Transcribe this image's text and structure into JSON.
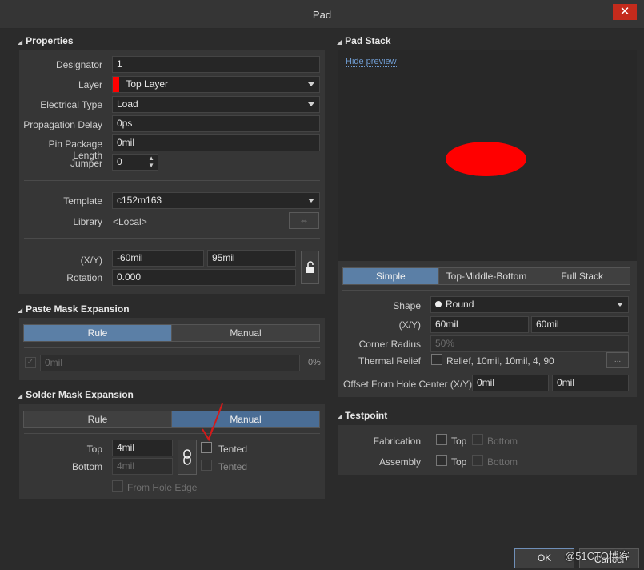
{
  "window": {
    "title": "Pad",
    "close_glyph": "✕"
  },
  "properties": {
    "heading": "Properties",
    "designator_label": "Designator",
    "designator_value": "1",
    "layer_label": "Layer",
    "layer_value": "Top Layer",
    "layer_color": "#ff0000",
    "electrical_type_label": "Electrical Type",
    "electrical_type_value": "Load",
    "propagation_delay_label": "Propagation Delay",
    "propagation_delay_value": "0ps",
    "pin_package_length_label": "Pin Package Length",
    "pin_package_length_value": "0mil",
    "jumper_label": "Jumper",
    "jumper_value": "0",
    "template_label": "Template",
    "template_value": "c152m163",
    "library_label": "Library",
    "library_value": "<Local>",
    "xy_label": "(X/Y)",
    "x_value": "-60mil",
    "y_value": "95mil",
    "rotation_label": "Rotation",
    "rotation_value": "0.000"
  },
  "paste_mask": {
    "heading": "Paste Mask Expansion",
    "tabs": [
      "Rule",
      "Manual"
    ],
    "value": "0mil",
    "percent": "0%"
  },
  "solder_mask": {
    "heading": "Solder Mask Expansion",
    "tabs": [
      "Rule",
      "Manual"
    ],
    "top_label": "Top",
    "top_value": "4mil",
    "bottom_label": "Bottom",
    "bottom_value": "4mil",
    "tented_label": "Tented",
    "tented_bottom_label": "Tented",
    "from_hole_edge_label": "From Hole Edge"
  },
  "pad_stack": {
    "heading": "Pad Stack",
    "hide_preview": "Hide preview",
    "pad_color": "#ff0000",
    "tabs": [
      "Simple",
      "Top-Middle-Bottom",
      "Full Stack"
    ],
    "shape_label": "Shape",
    "shape_value": "Round",
    "xy_label": "(X/Y)",
    "x_value": "60mil",
    "y_value": "60mil",
    "corner_radius_label": "Corner Radius",
    "corner_radius_value": "50%",
    "thermal_relief_label": "Thermal Relief",
    "thermal_relief_value": "Relief, 10mil, 10mil, 4, 90",
    "thermal_btn": "...",
    "offset_label": "Offset From Hole Center (X/Y)",
    "offset_x": "0mil",
    "offset_y": "0mil"
  },
  "testpoint": {
    "heading": "Testpoint",
    "fabrication_label": "Fabrication",
    "assembly_label": "Assembly",
    "top_label": "Top",
    "bottom_label": "Bottom"
  },
  "footer": {
    "ok_label": "OK",
    "cancel_label": "Cancel",
    "watermark": "@51CTO博客"
  }
}
